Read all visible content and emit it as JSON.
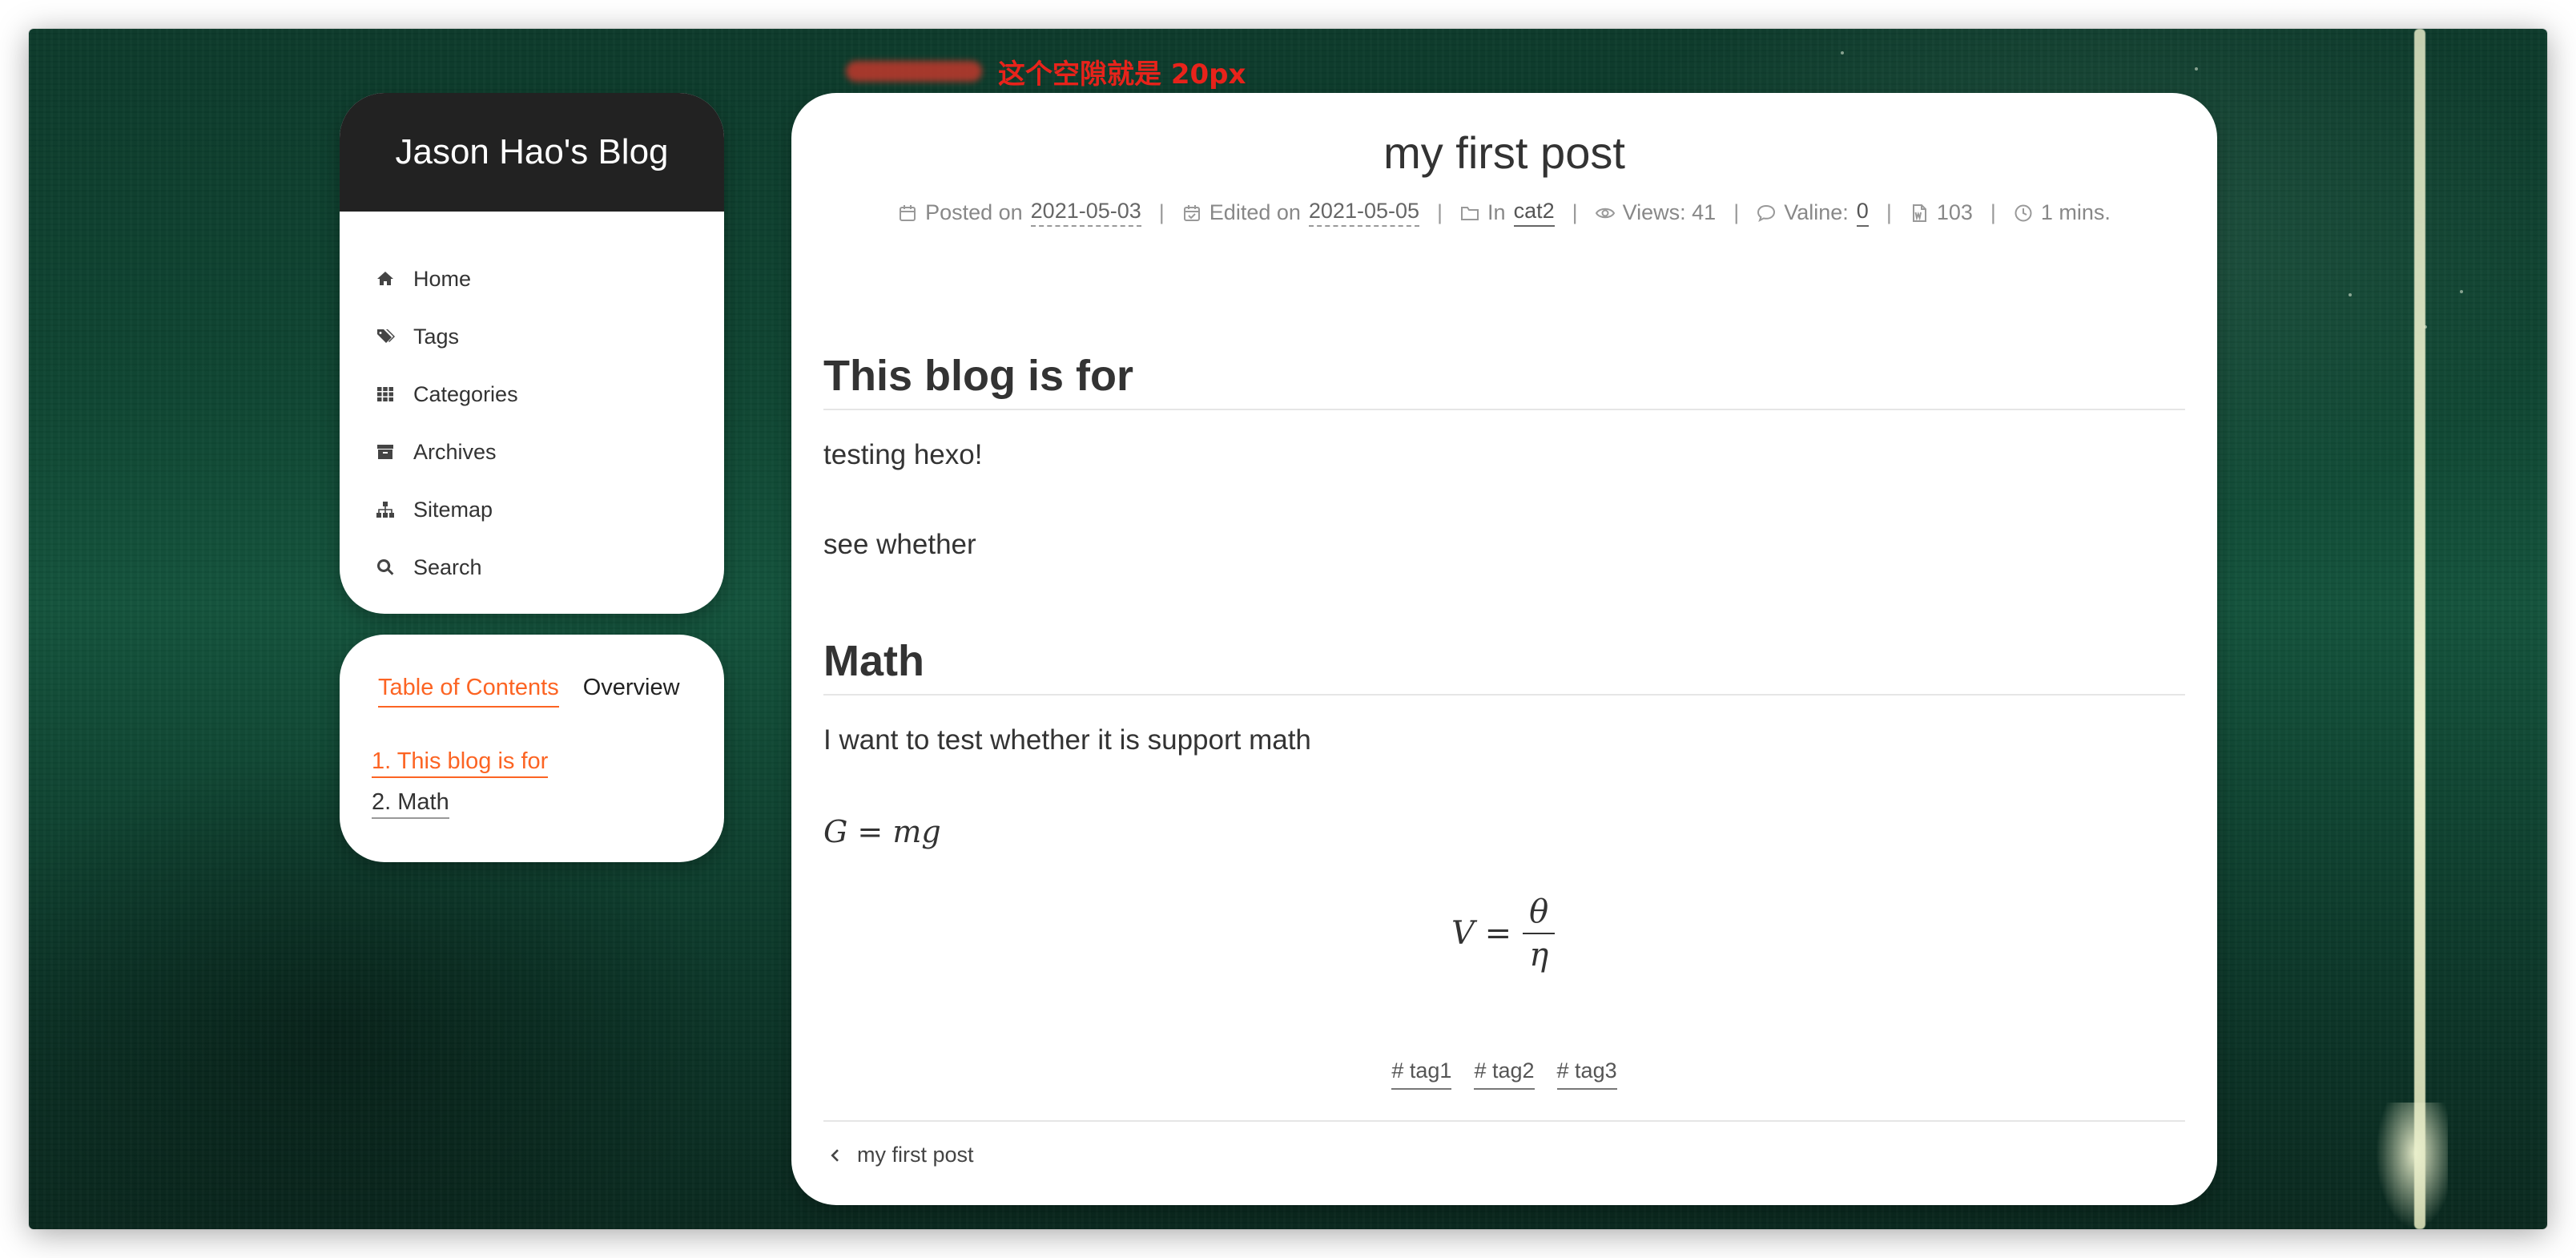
{
  "annotation": {
    "text": "这个空隙就是 20px"
  },
  "site": {
    "title": "Jason Hao's Blog"
  },
  "menu": [
    {
      "label": "Home",
      "icon": "home-icon"
    },
    {
      "label": "Tags",
      "icon": "tags-icon"
    },
    {
      "label": "Categories",
      "icon": "grid-icon"
    },
    {
      "label": "Archives",
      "icon": "archive-icon"
    },
    {
      "label": "Sitemap",
      "icon": "sitemap-icon"
    },
    {
      "label": "Search",
      "icon": "search-icon"
    }
  ],
  "toc": {
    "tabs": [
      "Table of Contents",
      "Overview"
    ],
    "items": [
      "1. This blog is for",
      "2. Math"
    ]
  },
  "post": {
    "title": "my first post",
    "meta": {
      "posted_label": "Posted on",
      "posted_date": "2021-05-03",
      "edited_label": "Edited on",
      "edited_date": "2021-05-05",
      "in_label": "In",
      "category": "cat2",
      "views": "Views: 41",
      "valine_label": "Valine:",
      "valine_count": "0",
      "words": "103",
      "reading_time": "1 mins."
    },
    "sections": [
      {
        "heading": "This blog is for",
        "paragraphs": [
          "testing hexo!",
          "see whether"
        ]
      },
      {
        "heading": "Math",
        "paragraphs": [
          "I want to test whether it is support math"
        ]
      }
    ],
    "math_inline": "G = mg",
    "math_display": {
      "lhs": "V =",
      "numerator": "θ",
      "denominator": "η"
    },
    "tags": [
      "# tag1",
      "# tag2",
      "# tag3"
    ],
    "prev_post": "my first post"
  },
  "colors": {
    "accent": "#fc6423",
    "header_bg": "#222222",
    "annotation": "#e8231b"
  }
}
